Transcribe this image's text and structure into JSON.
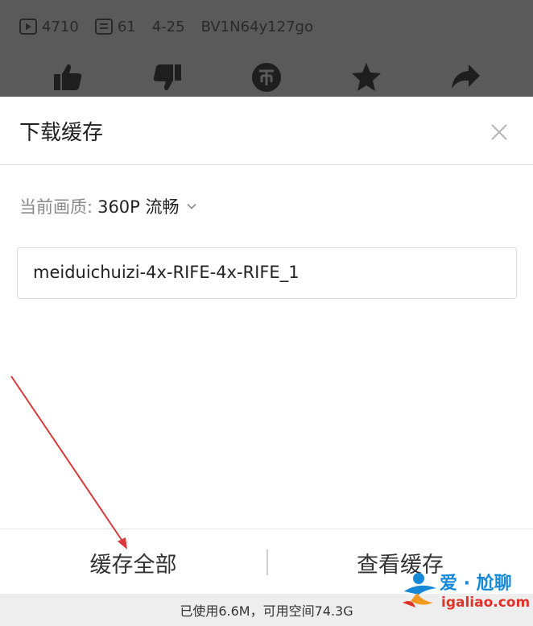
{
  "video_info": {
    "plays": "4710",
    "comments": "61",
    "date": "4-25",
    "bvid": "BV1N64y127go"
  },
  "action_icons": [
    "thumbs-up-icon",
    "thumbs-down-icon",
    "coin-icon",
    "star-icon",
    "share-icon"
  ],
  "sheet": {
    "title": "下载缓存",
    "quality_label": "当前画质:",
    "quality_value": "360P 流畅",
    "file_name": "meiduichuizi-4x-RIFE-4x-RIFE_1",
    "cache_all_label": "缓存全部",
    "view_cache_label": "查看缓存",
    "storage_text": "已使用6.6M，可用空间74.3G"
  },
  "watermark": {
    "title": "爱 · 尬聊",
    "url": "igaliao.com"
  },
  "colors": {
    "dim_overlay": "#5a5a5a",
    "annotation_arrow": "#d93a3a",
    "watermark_blue": "#1688d8",
    "watermark_red": "#e0342a"
  }
}
